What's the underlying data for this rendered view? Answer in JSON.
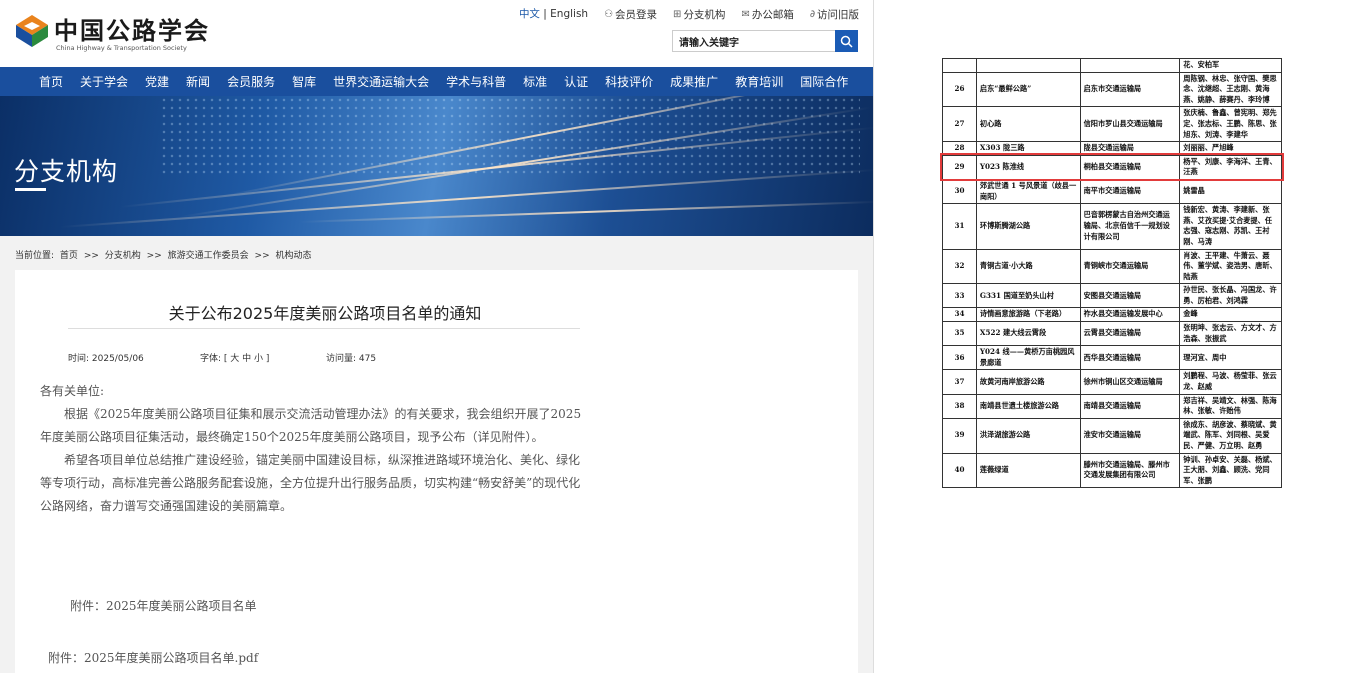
{
  "header": {
    "logo_cn": "中国公路学会",
    "logo_en": "China Highway & Transportation Society",
    "lang_cn": "中文",
    "lang_sep": " | ",
    "lang_en": "English",
    "links": [
      {
        "label": "会员登录",
        "icon": "user-icon"
      },
      {
        "label": "分支机构",
        "icon": "org-icon"
      },
      {
        "label": "办公邮箱",
        "icon": "mail-icon"
      },
      {
        "label": "访问旧版",
        "icon": "link-icon"
      }
    ],
    "search_placeholder": "请输入关键字"
  },
  "nav": [
    "首页",
    "关于学会",
    "党建",
    "新闻",
    "会员服务",
    "智库",
    "世界交通运输大会",
    "学术与科普",
    "标准",
    "认证",
    "科技评价",
    "成果推广",
    "教育培训",
    "国际合作"
  ],
  "banner": {
    "title": "分支机构"
  },
  "breadcrumb": {
    "prefix": "当前位置:",
    "items": [
      "首页",
      ">>",
      "分支机构",
      ">>",
      "旅游交通工作委员会",
      ">>",
      "机构动态"
    ]
  },
  "article": {
    "title": "关于公布2025年度美丽公路项目名单的通知",
    "date": "时间: 2025/05/06",
    "fontsize": "字体: [ 大 中 小 ]",
    "views": "访问量: 475",
    "salutation": "各有关单位:",
    "para1": "根据《2025年度美丽公路项目征集和展示交流活动管理办法》的有关要求，我会组织开展了2025年度美丽公路项目征集活动，最终确定150个2025年度美丽公路项目，现予公布（详见附件）。",
    "para2": "希望各项目单位总结推广建设经验，锚定美丽中国建设目标，纵深推进路域环境治化、美化、绿化等专项行动，高标准完善公路服务配套设施，全方位提升出行服务品质，切实构建“畅安舒美”的现代化公路网络，奋力谱写交通强国建设的美丽篇章。",
    "attach_line": "附件：2025年度美丽公路项目名单",
    "attach_file": "附件：2025年度美丽公路项目名单.pdf"
  },
  "table": {
    "rows": [
      {
        "no": "",
        "name": "",
        "unit": "",
        "people": "花、安柏军"
      },
      {
        "no": "26",
        "name": "启东“最鲜公路”",
        "unit": "启东市交通运输局",
        "people": "周陈钢、林忠、张守国、樊思念、沈继超、王志刚、黄海燕、姚静、薛赛丹、李玲博"
      },
      {
        "no": "27",
        "name": "初心路",
        "unit": "信阳市罗山县交通运输局",
        "people": "张庆楠、鲁鑫、曾宪明、郑先定、张志标、王鹏、陈思、张旭东、刘涛、李建华"
      },
      {
        "no": "28",
        "name": "X303 陇三路",
        "unit": "陇县交通运输局",
        "people": "刘丽丽、严旭峰"
      },
      {
        "no": "29",
        "name": "Y023 陈淮线",
        "unit": "桐柏县交通运输局",
        "people": "杨平、刘康、李海洋、王青、汪燕"
      },
      {
        "no": "30",
        "name": "郊武世通 1 号风景道（歧县一崗阳）",
        "unit": "南平市交通运输局",
        "people": "姚雷晶"
      },
      {
        "no": "31",
        "name": "环博斯腾湖公路",
        "unit": "巴音郭楞蒙古自治州交通运输局、北京佰信千一规划设计有限公司",
        "people": "钱新宏、黄涛、李建新、张燕、艾孜买提·艾合麦提、任志强、寇志刚、苏凯、王衬刚、马涛"
      },
      {
        "no": "32",
        "name": "青铜古道·小大路",
        "unit": "青铜峡市交通运输局",
        "people": "肖波、王平建、牛萧云、聂伟、董学斌、姿浩男、唐昕、陆燕"
      },
      {
        "no": "33",
        "name": "G331 国道至奶头山村",
        "unit": "安图县交通运输局",
        "people": "孙世民、张长晶、冯国龙、许勇、厉柏君、刘鸿霖"
      },
      {
        "no": "34",
        "name": "诗情画意旅游路（下老路）",
        "unit": "祚水县交通运输发展中心",
        "people": "金峰"
      },
      {
        "no": "35",
        "name": "X522 建大线云霄段",
        "unit": "云霄县交通运输局",
        "people": "张明坤、张志云、方文才、方浩森、张振武"
      },
      {
        "no": "36",
        "name": "Y024 线——黄桥万亩桃园风景廊道",
        "unit": "西华县交通运输局",
        "people": "理河宜、周中"
      },
      {
        "no": "37",
        "name": "故黄河南岸旅游公路",
        "unit": "徐州市铜山区交通运输局",
        "people": "刘鹏程、马波、杨莹菲、张云龙、赵威"
      },
      {
        "no": "38",
        "name": "南靖县世遗土楼旅游公路",
        "unit": "南靖县交通运输局",
        "people": "郑吉祥、吴靖文、林强、陈海林、张敏、许贻伟"
      },
      {
        "no": "39",
        "name": "洪泽湖旅游公路",
        "unit": "淮安市交通运输局",
        "people": "徐成东、胡彦波、蔡晓斌、黄端武、陈军、刘同根、吴爱民、严健、万立明、赵勇"
      },
      {
        "no": "40",
        "name": "莲薇绿道",
        "unit": "滕州市交通运输局、滕州市交通发展集团有限公司",
        "people": "钟训、孙卓安、关磊、杨斌、王大朋、刘鑫、顾洗、党同军、张鹏"
      }
    ],
    "highlight_color": "#e23b3b"
  },
  "colors": {
    "nav_bg": "#1a4f9e",
    "accent": "#1a5bb5",
    "highlight": "#e23b3b"
  }
}
